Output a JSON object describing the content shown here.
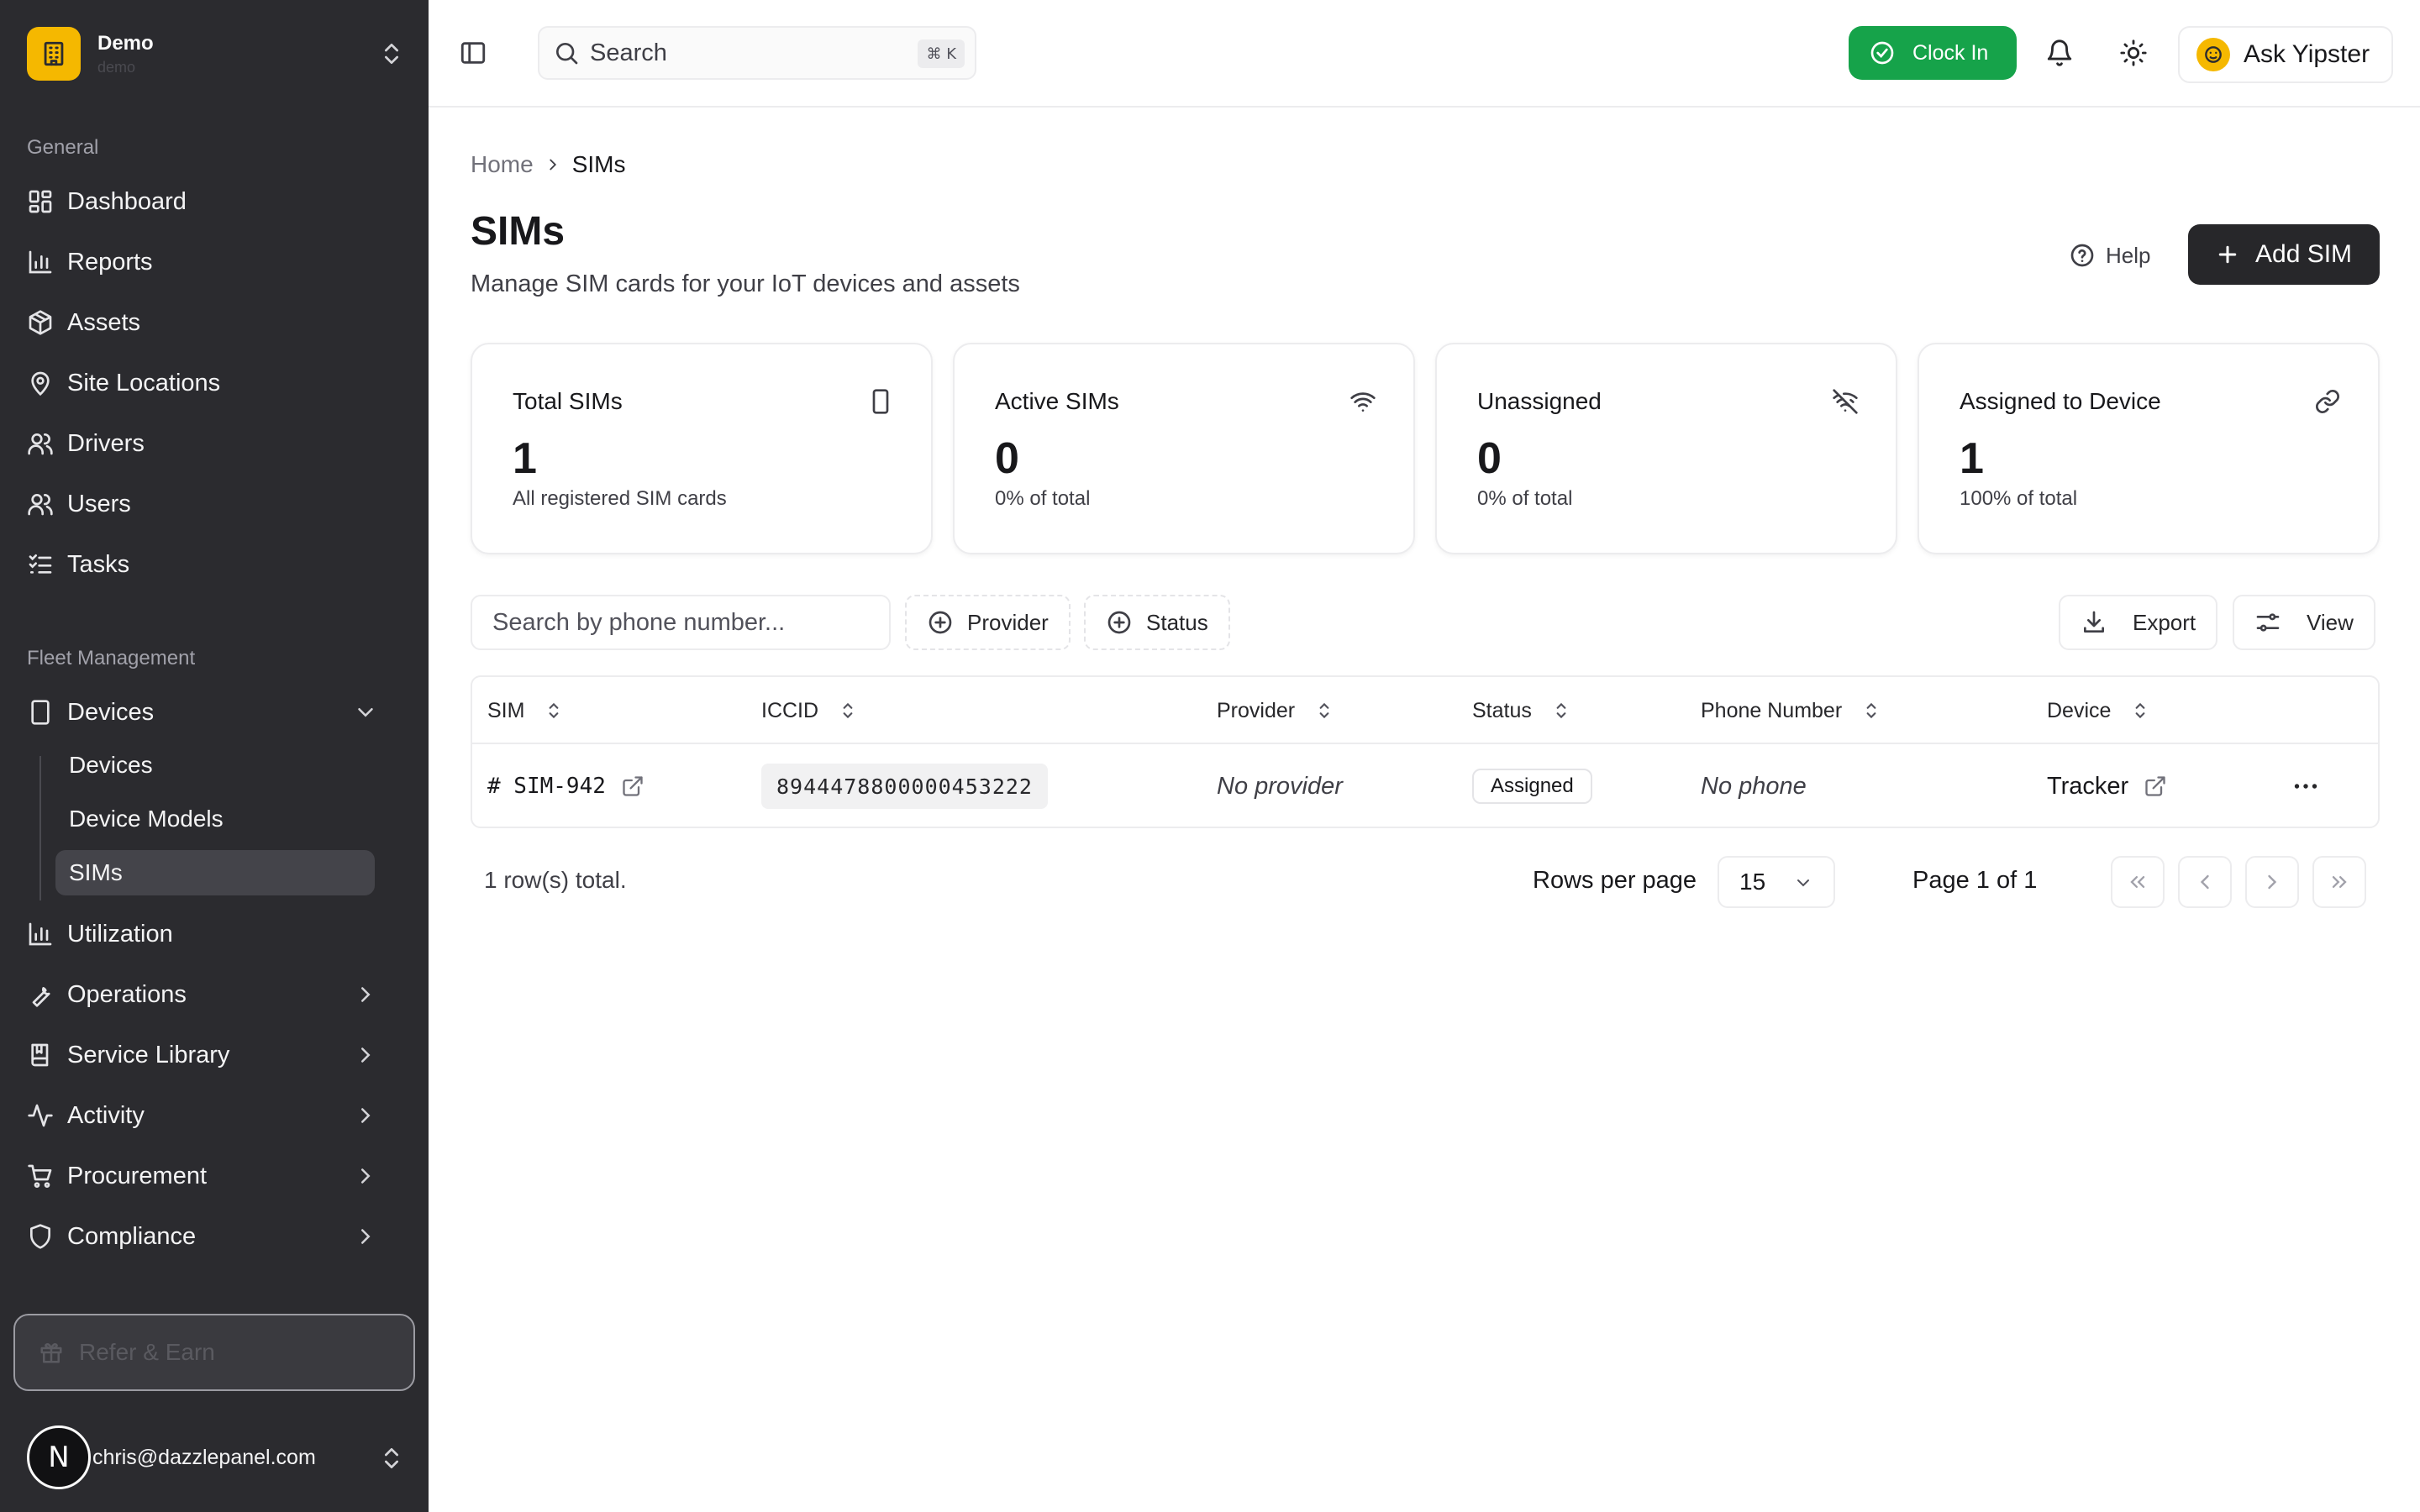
{
  "sidebar": {
    "org": {
      "name": "Demo",
      "sub": "demo"
    },
    "general_label": "General",
    "general_items": [
      {
        "label": "Dashboard",
        "icon": "dashboard-icon"
      },
      {
        "label": "Reports",
        "icon": "bar-chart-icon"
      },
      {
        "label": "Assets",
        "icon": "package-icon"
      },
      {
        "label": "Site Locations",
        "icon": "map-pin-icon"
      },
      {
        "label": "Drivers",
        "icon": "users-icon"
      },
      {
        "label": "Users",
        "icon": "users-icon"
      },
      {
        "label": "Tasks",
        "icon": "list-checks-icon"
      }
    ],
    "fleet_label": "Fleet Management",
    "devices": {
      "label": "Devices",
      "expanded": true,
      "children": [
        "Devices",
        "Device Models",
        "SIMs"
      ],
      "active_child": "SIMs"
    },
    "fleet_items": [
      {
        "label": "Utilization",
        "icon": "bar-chart-icon"
      },
      {
        "label": "Operations",
        "icon": "wrench-icon"
      },
      {
        "label": "Service Library",
        "icon": "book-icon"
      },
      {
        "label": "Activity",
        "icon": "activity-icon"
      },
      {
        "label": "Procurement",
        "icon": "cart-icon"
      },
      {
        "label": "Compliance",
        "icon": "shield-icon"
      }
    ],
    "refer": "Refer & Earn",
    "user": {
      "avatar_letter": "N",
      "email": "chris@dazzlepanel.com"
    }
  },
  "topbar": {
    "search_label": "Search",
    "search_kbd": "⌘ K",
    "clock_in": "Clock In",
    "ask": "Ask Yipster"
  },
  "breadcrumb": {
    "home": "Home",
    "current": "SIMs"
  },
  "page": {
    "title": "SIMs",
    "subtitle": "Manage SIM cards for your IoT devices and assets",
    "help": "Help",
    "add": "Add SIM"
  },
  "stats": [
    {
      "title": "Total SIMs",
      "value": "1",
      "desc": "All registered SIM cards",
      "icon": "smartphone-icon"
    },
    {
      "title": "Active SIMs",
      "value": "0",
      "desc": "0% of total",
      "icon": "wifi-icon"
    },
    {
      "title": "Unassigned",
      "value": "0",
      "desc": "0% of total",
      "icon": "wifi-off-icon"
    },
    {
      "title": "Assigned to Device",
      "value": "1",
      "desc": "100% of total",
      "icon": "link-icon"
    }
  ],
  "toolbar": {
    "search_placeholder": "Search by phone number...",
    "provider": "Provider",
    "status": "Status",
    "export": "Export",
    "view": "View"
  },
  "table": {
    "columns": [
      "SIM",
      "ICCID",
      "Provider",
      "Status",
      "Phone Number",
      "Device"
    ],
    "rows": [
      {
        "sim": "# SIM-942",
        "iccid": "8944478800000453222",
        "provider": "No provider",
        "status": "Assigned",
        "phone": "No phone",
        "device": "Tracker"
      }
    ]
  },
  "pagination": {
    "total": "1 row(s) total.",
    "rows_per_page_label": "Rows per page",
    "rows_per_page": "15",
    "page_info": "Page 1 of 1"
  },
  "colors": {
    "sidebar_bg": "#2b2b2f",
    "brand_yellow": "#f5b800",
    "clock_in_green": "#16a34a",
    "primary_button": "#27272a"
  }
}
